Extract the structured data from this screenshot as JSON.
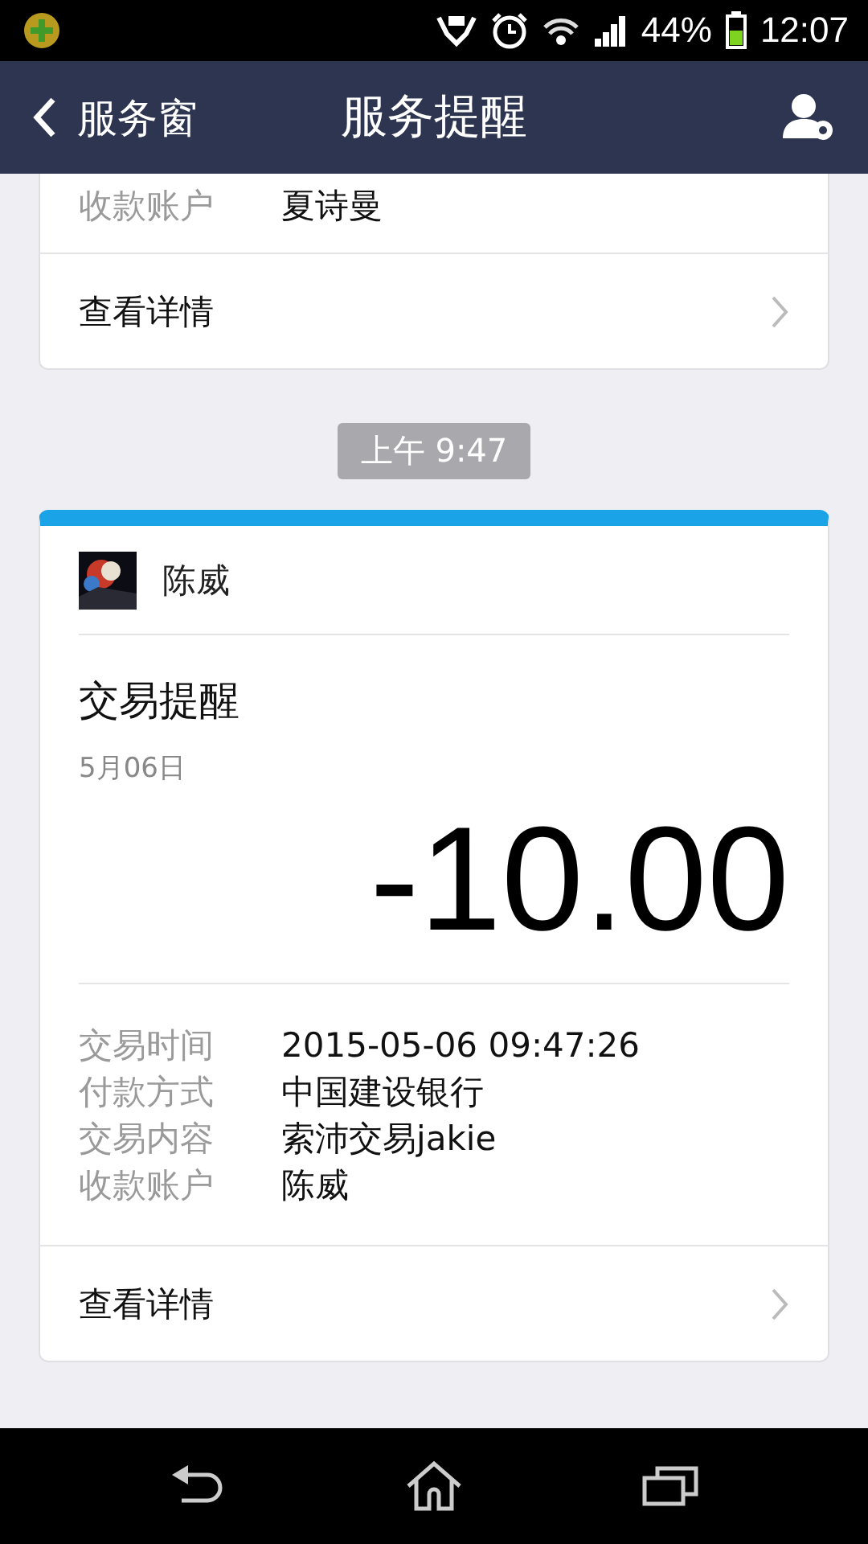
{
  "status_bar": {
    "battery": "44%",
    "time": "12:07"
  },
  "header": {
    "back_label": "服务窗",
    "title": "服务提醒"
  },
  "earlier_card": {
    "fields": [
      {
        "label": "收款账户",
        "value": "夏诗曼"
      }
    ],
    "details_link": "查看详情"
  },
  "time_stamp": "上午 9:47",
  "card": {
    "sender": "陈威",
    "title": "交易提醒",
    "date": "5月06日",
    "amount": "-10.00",
    "fields": [
      {
        "label": "交易时间",
        "value": "2015-05-06 09:47:26"
      },
      {
        "label": "付款方式",
        "value": "中国建设银行"
      },
      {
        "label": "交易内容",
        "value": "索沛交易jakie"
      },
      {
        "label": "收款账户",
        "value": "陈威"
      }
    ],
    "details_link": "查看详情"
  }
}
